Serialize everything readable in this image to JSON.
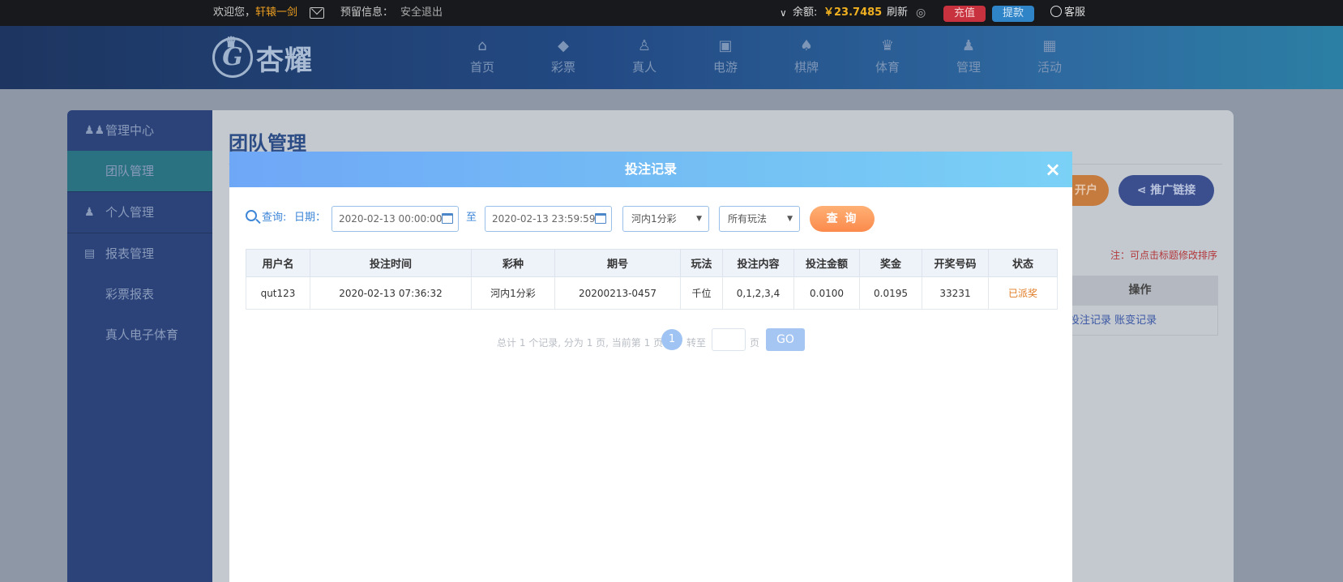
{
  "topbar": {
    "welcome": "欢迎您，",
    "username": "轩辕一剑",
    "reserve_info": "预留信息：",
    "logout": "安全退出",
    "chevron": "∨",
    "balance_label": "余额:",
    "balance": "￥23.7485",
    "refresh": "刷新",
    "recharge": "充值",
    "withdraw": "提款",
    "service": "客服"
  },
  "header": {
    "logo_text": "杏耀",
    "logo_letter": "G",
    "nav": [
      {
        "label": "首页",
        "icon": "home-icon",
        "glyph": "⌂"
      },
      {
        "label": "彩票",
        "icon": "lottery-icon",
        "glyph": "◆"
      },
      {
        "label": "真人",
        "icon": "live-dealer-icon",
        "glyph": "♙"
      },
      {
        "label": "电游",
        "icon": "slot-machine-icon",
        "glyph": "▣"
      },
      {
        "label": "棋牌",
        "icon": "cards-icon",
        "glyph": "♠"
      },
      {
        "label": "体育",
        "icon": "trophy-icon",
        "glyph": "♛"
      },
      {
        "label": "管理",
        "icon": "users-icon",
        "glyph": "♟"
      },
      {
        "label": "活动",
        "icon": "gift-icon",
        "glyph": "▦"
      }
    ]
  },
  "sidebar": {
    "items": [
      {
        "label": "管理中心",
        "icon": "group-icon"
      },
      {
        "label": "团队管理",
        "icon": ""
      },
      {
        "label": "个人管理",
        "icon": "person-icon"
      },
      {
        "label": "报表管理",
        "icon": "report-icon"
      },
      {
        "label": "彩票报表",
        "icon": ""
      },
      {
        "label": "真人电子体育",
        "icon": ""
      }
    ]
  },
  "page": {
    "title": "团队管理",
    "open_account": "开户",
    "promo_link": "推广链接",
    "note": "注：可点击标题修改排序",
    "ops_header": "操作",
    "ops_links": "投注记录 账变记录"
  },
  "modal": {
    "title": "投注记录",
    "close": "×",
    "query_label": "查询:",
    "date_label": "日期：",
    "date_from": "2020-02-13 00:00:00",
    "to": "至",
    "date_to": "2020-02-13 23:59:59",
    "lottery_select": "河内1分彩",
    "play_select": "所有玩法",
    "query_button": "查 询",
    "table": {
      "headers": [
        "用户名",
        "投注时间",
        "彩种",
        "期号",
        "玩法",
        "投注内容",
        "投注金额",
        "奖金",
        "开奖号码",
        "状态"
      ],
      "rows": [
        [
          "qut123",
          "2020-02-13 07:36:32",
          "河内1分彩",
          "20200213-0457",
          "千位",
          "0,1,2,3,4",
          "0.0100",
          "0.0195",
          "33231",
          "已派奖"
        ]
      ]
    },
    "pager": {
      "summary": "总计 1 个记录, 分为 1 页, 当前第 1 页",
      "current": "1",
      "jump_to": "转至",
      "page_unit": "页",
      "go": "GO"
    }
  },
  "colors": {
    "accent": "#3d86d8",
    "status_paid": "#e07a22",
    "balance": "#f0b020",
    "modal_header": "#74c0f4"
  }
}
